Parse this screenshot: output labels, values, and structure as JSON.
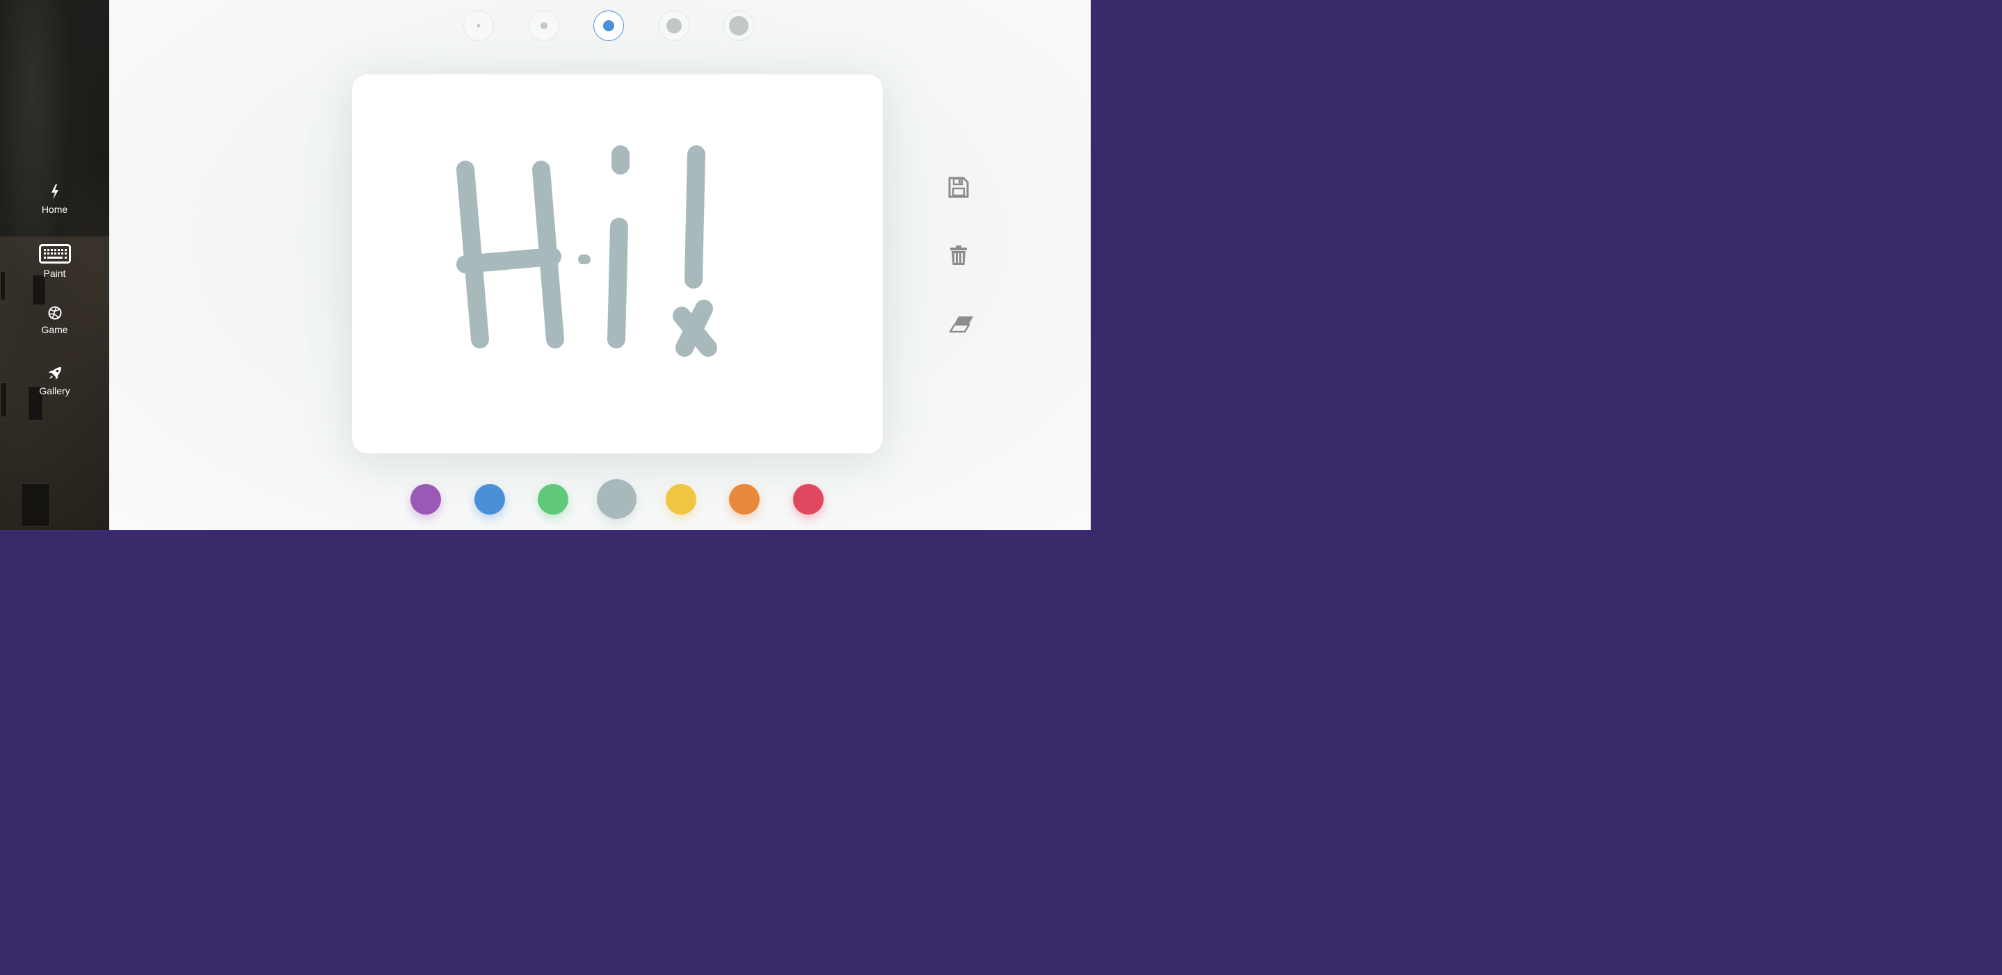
{
  "sidebar": {
    "items": [
      {
        "label": "Home",
        "icon": "bolt-icon"
      },
      {
        "label": "Paint",
        "icon": "keyboard-icon"
      },
      {
        "label": "Game",
        "icon": "basketball-icon"
      },
      {
        "label": "Gallery",
        "icon": "rocket-icon"
      }
    ]
  },
  "brush_sizes": {
    "options": [
      "size-1",
      "size-2",
      "size-3",
      "size-4",
      "size-5"
    ],
    "selected_index": 2,
    "active_color": "#4a90d9"
  },
  "canvas": {
    "drawing_color": "#a8b9bc",
    "drawing_description_icon": "hand-drawn-strokes"
  },
  "tools": [
    {
      "name": "save",
      "icon": "floppy-disk-icon"
    },
    {
      "name": "delete",
      "icon": "trash-icon"
    },
    {
      "name": "eraser",
      "icon": "eraser-icon"
    }
  ],
  "palette": {
    "colors": [
      "#9b59b6",
      "#4a90d9",
      "#5fc879",
      "#a8b9bc",
      "#f0c542",
      "#e8883a",
      "#e0485f"
    ],
    "selected_index": 3
  }
}
